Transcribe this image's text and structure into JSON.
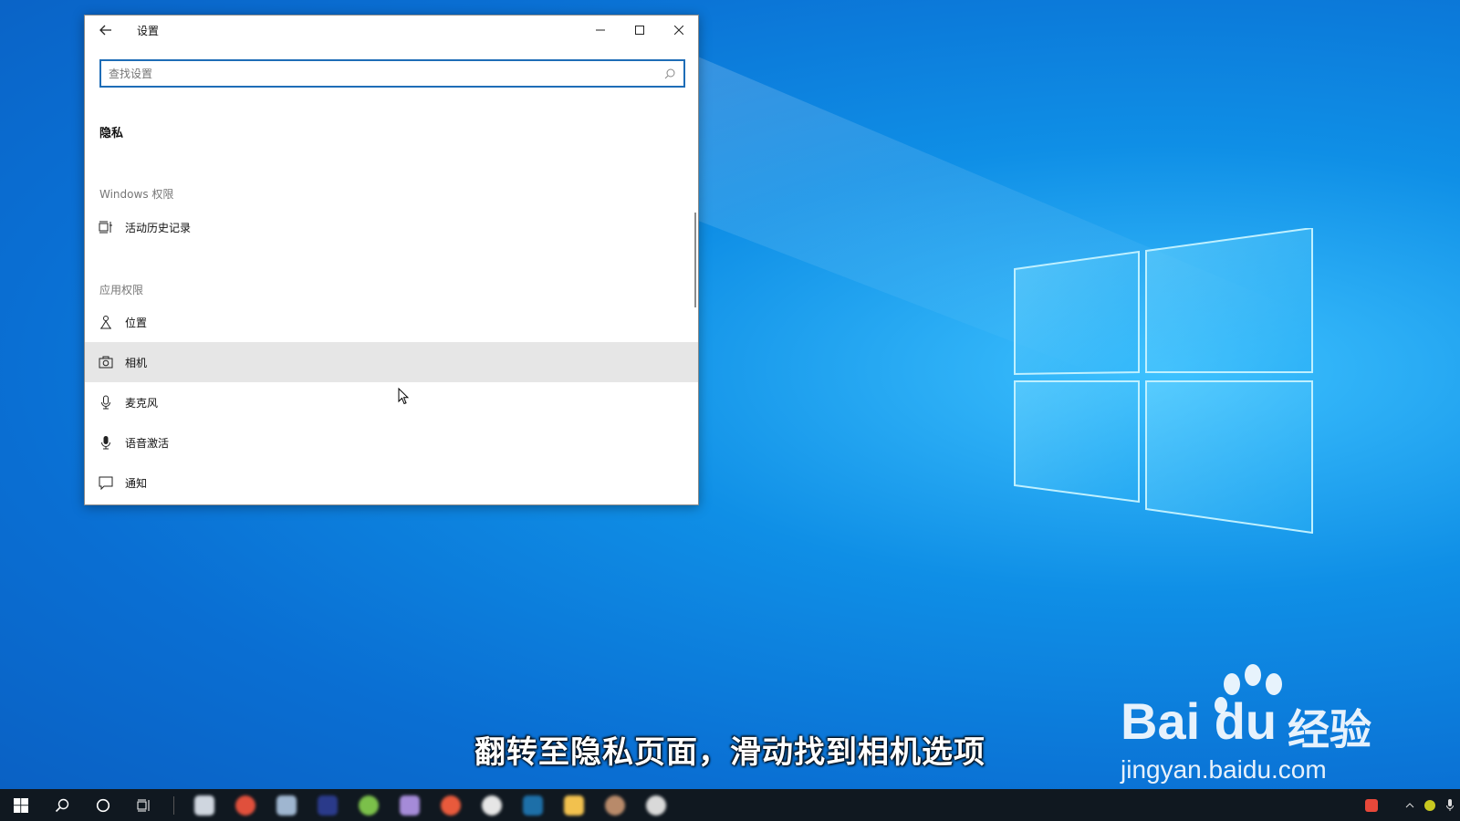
{
  "window": {
    "title": "设置",
    "search_placeholder": "查找设置",
    "page_title": "隐私"
  },
  "sections": {
    "windows_permissions": "Windows 权限",
    "app_permissions": "应用权限"
  },
  "items": [
    {
      "label": "活动历史记录",
      "icon": "activity-history-icon"
    },
    {
      "label": "位置",
      "icon": "location-icon"
    },
    {
      "label": "相机",
      "icon": "camera-icon"
    },
    {
      "label": "麦克风",
      "icon": "microphone-icon"
    },
    {
      "label": "语音激活",
      "icon": "voice-activation-icon"
    },
    {
      "label": "通知",
      "icon": "notification-icon"
    }
  ],
  "caption": "翻转至隐私页面，滑动找到相机选项",
  "watermark": {
    "brand": "Bai du",
    "brand_cn": "经验",
    "url": "jingyan.baidu.com"
  },
  "colors": {
    "accent": "#1e6db7",
    "hover": "#e6e6e6",
    "desktop": "#0f8fe6",
    "taskbar": "#101820"
  }
}
